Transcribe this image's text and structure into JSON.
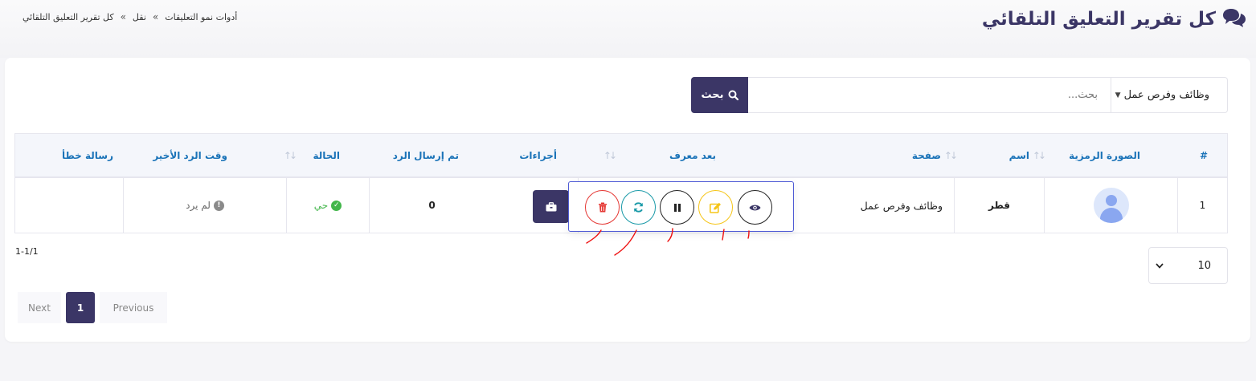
{
  "header": {
    "title": "كل تقرير التعليق التلقائي",
    "breadcrumb": [
      "أدوات نمو التعليقات",
      "نقل",
      "كل تقرير التعليق التلقائي"
    ],
    "breadcrumb_sep": "»"
  },
  "filters": {
    "category": "وظائف وفرص عمل",
    "search_placeholder": "بحث...",
    "search_label": "بحث"
  },
  "table": {
    "columns": [
      "#",
      "الصورة الرمزية",
      "اسم",
      "صفحة",
      "بعد معرف",
      "أجراءات",
      "تم إرسال الرد",
      "الحالة",
      "وقت الرد الأخير",
      "رسالة خطأ"
    ],
    "rows": [
      {
        "index": "1",
        "name": "قطر",
        "page": "وظائف وفرص عمل",
        "post_id": "",
        "replies_sent": "0",
        "status": "حي",
        "last_reply_time": "لم يرد",
        "error_message": ""
      }
    ]
  },
  "action_icons": [
    "eye-icon",
    "edit-icon",
    "pause-icon",
    "refresh-icon",
    "trash-icon"
  ],
  "pagination": {
    "per_page": "10",
    "range": "1-1/1",
    "previous": "Previous",
    "current": "1",
    "next": "Next"
  },
  "colors": {
    "primary": "#3b3666",
    "header_link": "#1a73b8",
    "live": "#42b64a",
    "delete": "#e53935",
    "refresh": "#1a9aa8",
    "edit": "#f5c518",
    "popup_border": "#4f5bd5"
  }
}
